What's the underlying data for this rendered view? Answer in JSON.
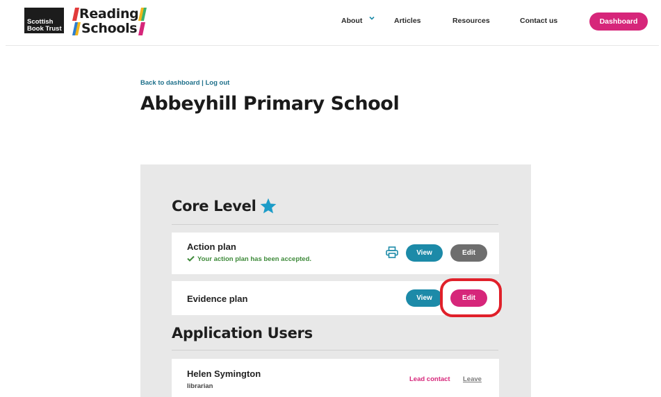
{
  "header": {
    "sbt_logo": "Scottish Book Trust",
    "rs_logo": "Reading Schools",
    "nav": {
      "about": "About",
      "articles": "Articles",
      "resources": "Resources",
      "contact": "Contact us"
    },
    "dashboard_label": "Dashboard",
    "accent_color": "#d6267a"
  },
  "breadcrumb": {
    "back": "Back to dashboard",
    "separator": " | ",
    "logout": "Log out"
  },
  "page_title": "Abbeyhill Primary School",
  "core_level": {
    "title": "Core Level",
    "star_icon": "star-icon",
    "items": [
      {
        "title": "Action plan",
        "status": "Your action plan has been accepted.",
        "view_label": "View",
        "edit_label": "Edit"
      },
      {
        "title": "Evidence plan",
        "view_label": "View",
        "edit_label": "Edit"
      }
    ]
  },
  "application_users": {
    "title": "Application Users",
    "users": [
      {
        "name": "Helen Symington",
        "role": "librarian",
        "lead_label": "Lead contact",
        "leave_label": "Leave"
      }
    ]
  }
}
